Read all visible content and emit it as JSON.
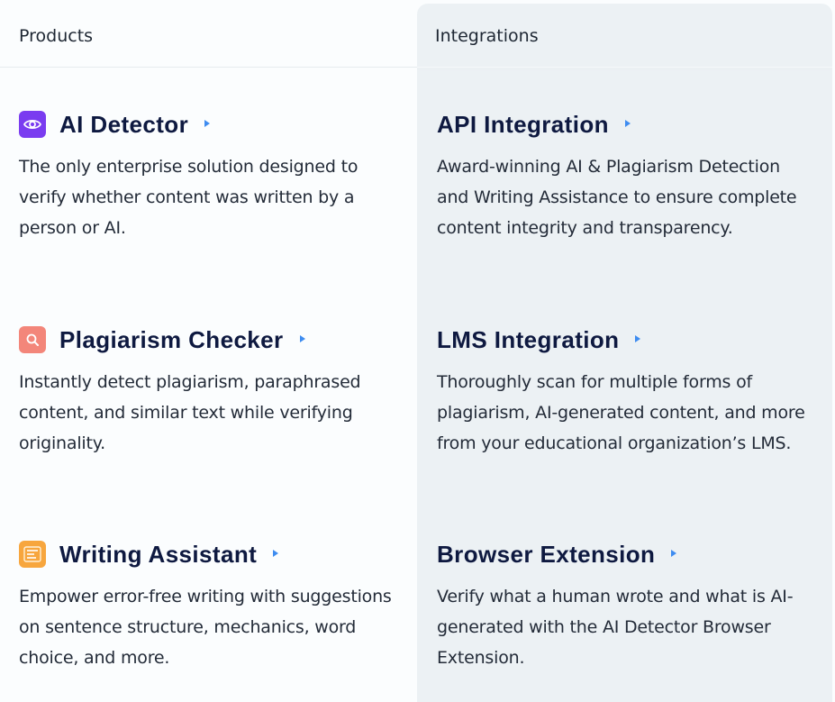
{
  "tabs": {
    "products": "Products",
    "integrations": "Integrations"
  },
  "products": [
    {
      "title": "AI Detector",
      "icon": "eye-icon",
      "description": "The only enterprise solution designed to verify whether content was written by a person or AI."
    },
    {
      "title": "Plagiarism Checker",
      "icon": "magnifier-icon",
      "description": "Instantly detect plagiarism, paraphrased content, and similar text while verifying originality."
    },
    {
      "title": "Writing Assistant",
      "icon": "document-lines-icon",
      "description": "Empower error-free writing with suggestions on sentence structure, mechanics, word choice, and more."
    }
  ],
  "integrations": [
    {
      "title": "API Integration",
      "description": "Award-winning AI & Plagiarism Detection and Writing Assistance to ensure complete content integrity and transparency."
    },
    {
      "title": "LMS Integration",
      "description": "Thoroughly scan for multiple forms of plagiarism, AI-generated content, and more from your educational organization’s LMS."
    },
    {
      "title": "Browser Extension",
      "description": "Verify what a human wrote and what is AI-generated with the AI Detector Browser Extension."
    }
  ],
  "colors": {
    "title": "#0e1940",
    "arrow": "#3e8cf0",
    "integrations_bg": "#ecf1f4",
    "ai_icon": "#7a3cf0",
    "plagiarism_icon": "#f3867a",
    "writing_icon": "#f7a63e"
  }
}
